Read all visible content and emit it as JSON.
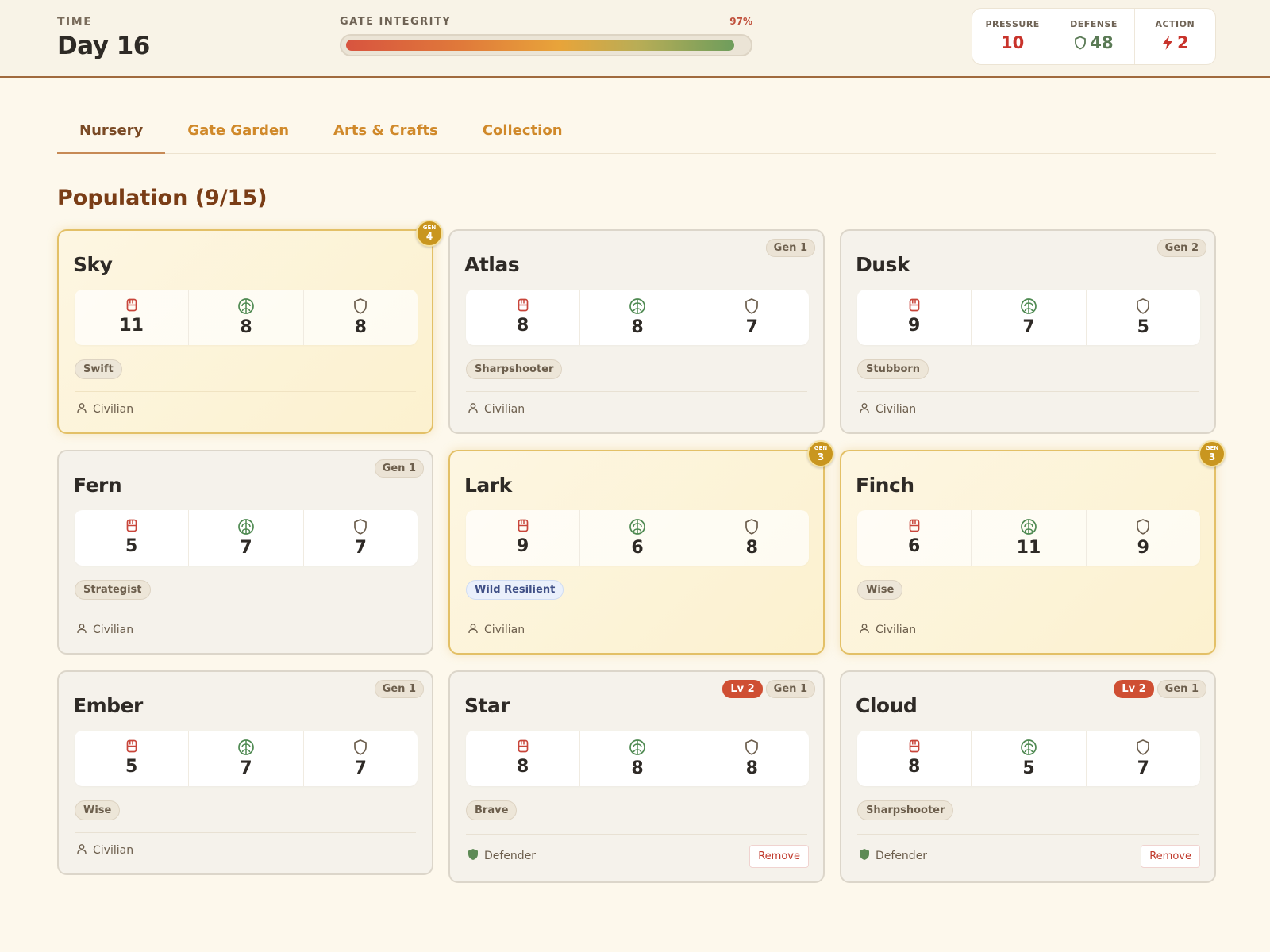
{
  "header": {
    "time_label": "TIME",
    "time_value": "Day 16",
    "gate_label": "GATE INTEGRITY",
    "gate_percent_text": "97%",
    "gate_fraction": 0.97,
    "stats": [
      {
        "label": "PRESSURE",
        "value": "10",
        "color": "#c8332b"
      },
      {
        "label": "DEFENSE",
        "value": "48",
        "color": "#5a7a55"
      },
      {
        "label": "ACTION",
        "value": "2",
        "color": "#c8332b"
      }
    ]
  },
  "tabs": [
    {
      "label": "Nursery",
      "active": true
    },
    {
      "label": "Gate Garden",
      "active": false
    },
    {
      "label": "Arts & Crafts",
      "active": false
    },
    {
      "label": "Collection",
      "active": false
    }
  ],
  "population": {
    "title": "Population (9/15)"
  },
  "cards": [
    {
      "name": "Sky",
      "gen_coin": {
        "label": "GEN",
        "value": "4"
      },
      "stats": [
        "11",
        "8",
        "8"
      ],
      "trait": "Swift",
      "role": "Civilian"
    },
    {
      "name": "Atlas",
      "badges": {
        "gen": "Gen 1"
      },
      "stats": [
        "8",
        "8",
        "7"
      ],
      "trait": "Sharpshooter",
      "role": "Civilian"
    },
    {
      "name": "Dusk",
      "badges": {
        "gen": "Gen 2"
      },
      "stats": [
        "9",
        "7",
        "5"
      ],
      "trait": "Stubborn",
      "role": "Civilian"
    },
    {
      "name": "Fern",
      "badges": {
        "gen": "Gen 1"
      },
      "stats": [
        "5",
        "7",
        "7"
      ],
      "trait": "Strategist",
      "role": "Civilian"
    },
    {
      "name": "Lark",
      "gen_coin": {
        "label": "GEN",
        "value": "3"
      },
      "stats": [
        "9",
        "6",
        "8"
      ],
      "trait": "Wild Resilient",
      "role": "Civilian"
    },
    {
      "name": "Finch",
      "gen_coin": {
        "label": "GEN",
        "value": "3"
      },
      "stats": [
        "6",
        "11",
        "9"
      ],
      "trait": "Wise",
      "role": "Civilian"
    },
    {
      "name": "Ember",
      "badges": {
        "gen": "Gen 1"
      },
      "stats": [
        "5",
        "7",
        "7"
      ],
      "trait": "Wise",
      "role": "Civilian"
    },
    {
      "name": "Star",
      "badges": {
        "lv": "Lv 2",
        "gen": "Gen 1"
      },
      "stats": [
        "8",
        "8",
        "8"
      ],
      "trait": "Brave",
      "role": "Defender",
      "remove_label": "Remove"
    },
    {
      "name": "Cloud",
      "badges": {
        "lv": "Lv 2",
        "gen": "Gen 1"
      },
      "stats": [
        "8",
        "5",
        "7"
      ],
      "trait": "Sharpshooter",
      "role": "Defender",
      "remove_label": "Remove"
    }
  ],
  "icons": {
    "stat_icons": [
      "fist-icon",
      "brain-icon",
      "shield-icon"
    ],
    "civilian_icon": "person-icon",
    "defender_icon": "filled-shield-icon"
  }
}
